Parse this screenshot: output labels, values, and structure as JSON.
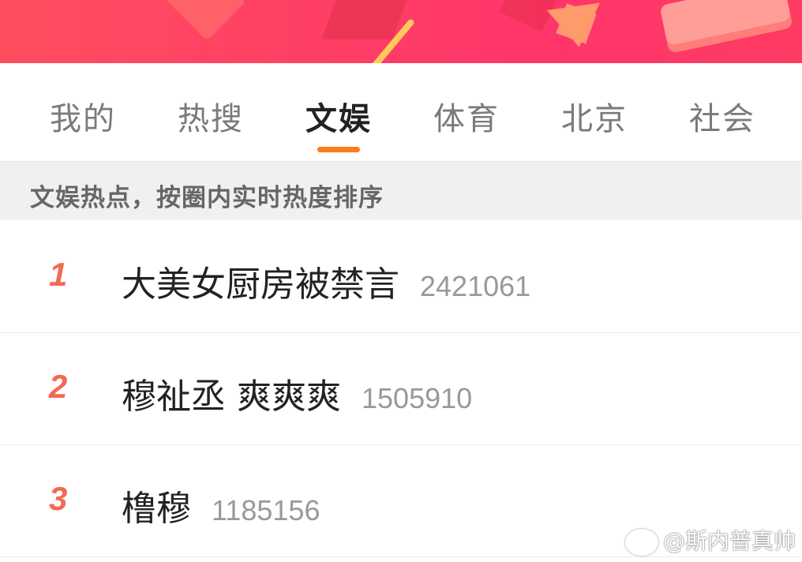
{
  "tabs": [
    {
      "label": "我的",
      "active": false
    },
    {
      "label": "热搜",
      "active": false
    },
    {
      "label": "文娱",
      "active": true
    },
    {
      "label": "体育",
      "active": false
    },
    {
      "label": "北京",
      "active": false
    },
    {
      "label": "社会",
      "active": false
    }
  ],
  "subheader": {
    "text": "文娱热点，按圈内实时热度排序"
  },
  "list": [
    {
      "rank": "1",
      "title": "大美女厨房被禁言",
      "count": "2421061"
    },
    {
      "rank": "2",
      "title": "穆祉丞 爽爽爽",
      "count": "1505910"
    },
    {
      "rank": "3",
      "title": "橹穆",
      "count": "1185156"
    }
  ],
  "watermark": {
    "text": "@斯内普真帅",
    "icon": "weibo-icon"
  },
  "colors": {
    "banner": "#ff3f66",
    "indicator": "#ff7a1a",
    "rank": "#f26a55",
    "active_tab": "#222222",
    "inactive_tab": "#7a7a7a"
  }
}
